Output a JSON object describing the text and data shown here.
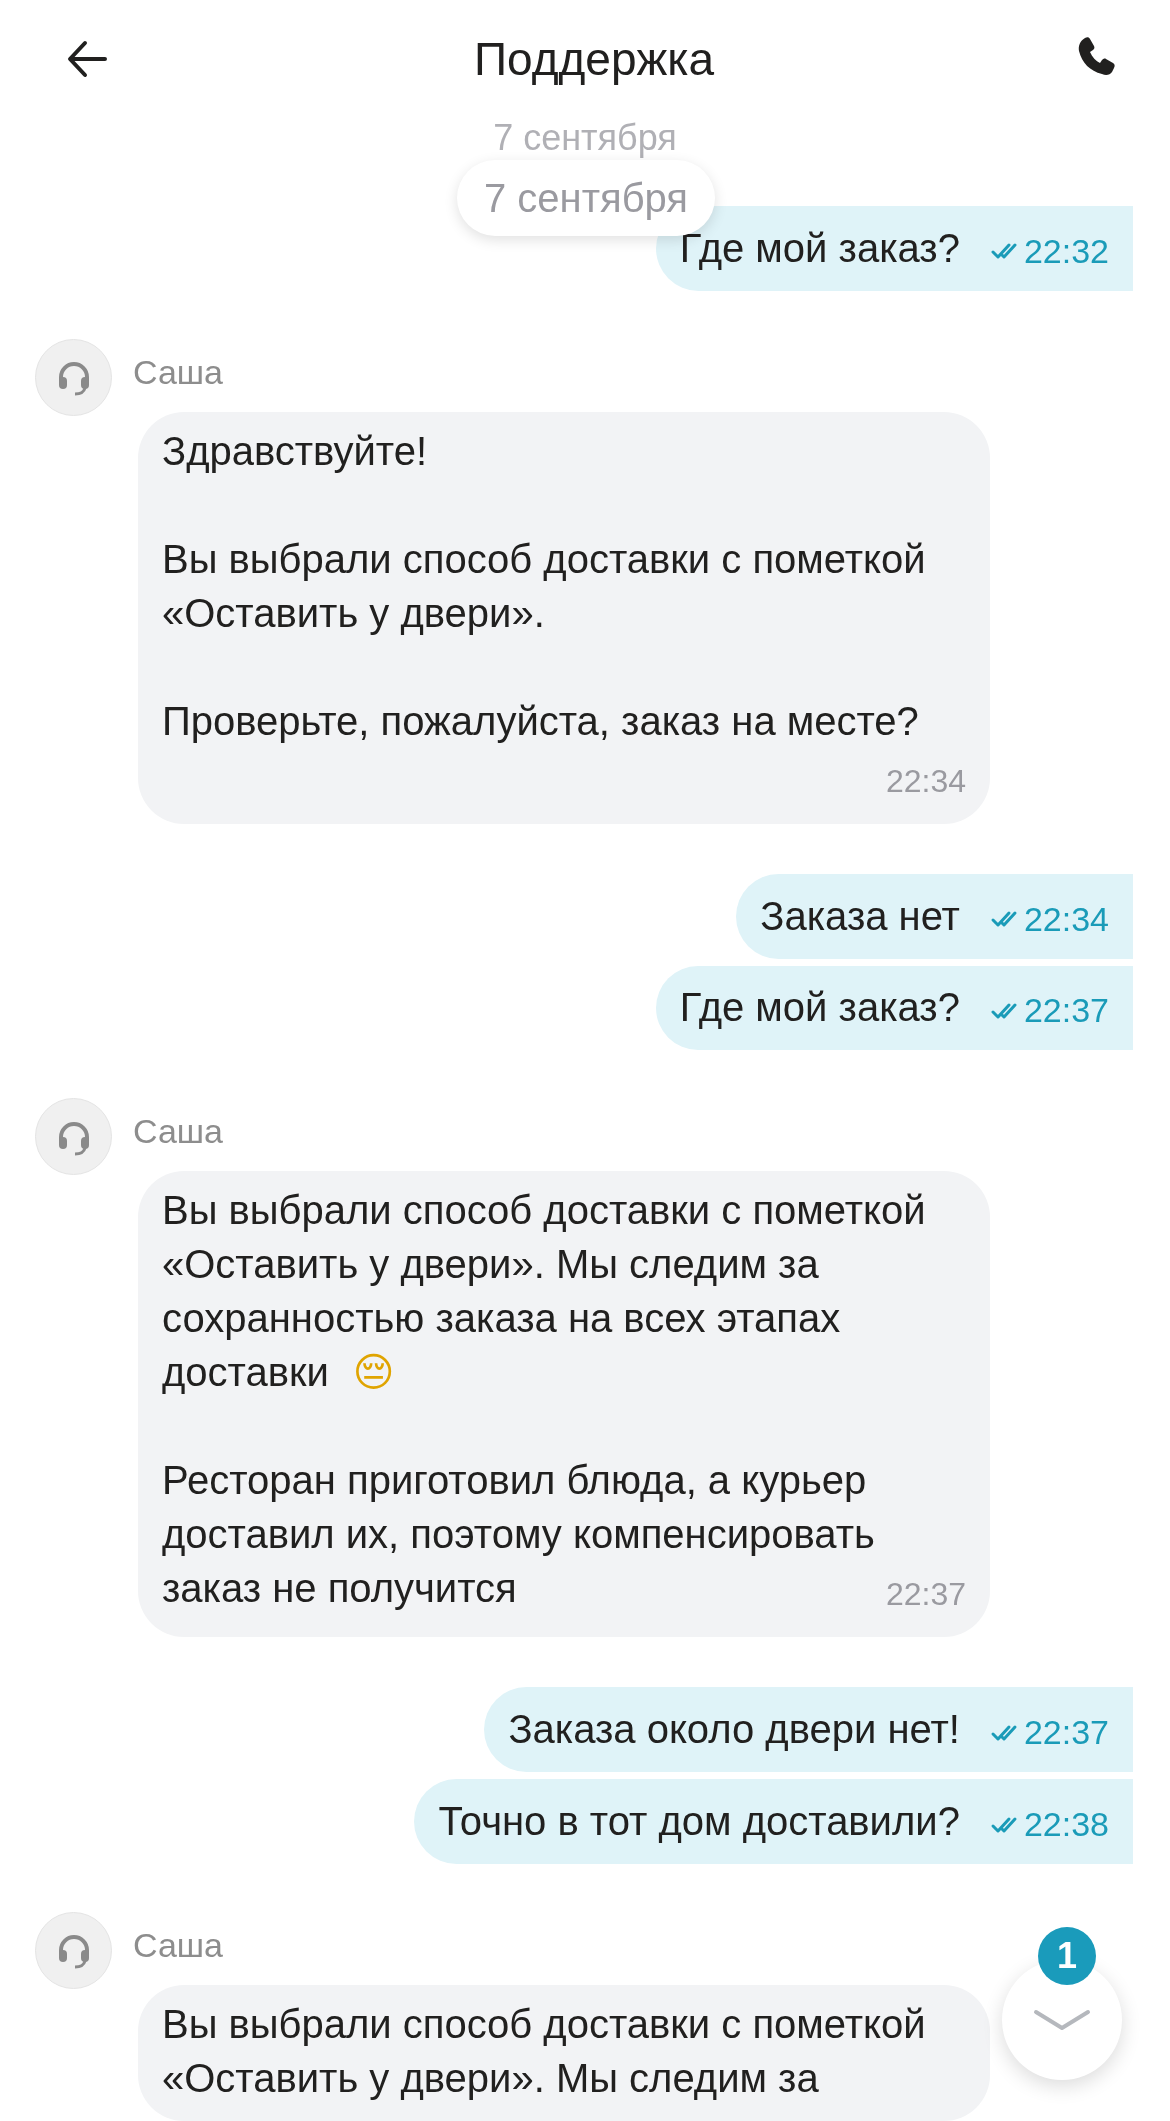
{
  "header": {
    "title": "Поддержка"
  },
  "scrolled_date": "7 сентября",
  "sticky_date": "7 сентября",
  "messages": [
    {
      "kind": "outgoing",
      "text": "Где мой заказ?",
      "time": "22:32",
      "read": true
    },
    {
      "kind": "incoming",
      "sender": "Саша",
      "paragraphs": [
        {
          "kind": "plain",
          "text": "Здравствуйте!"
        },
        {
          "kind": "plain",
          "text": "Вы выбрали способ доставки с пометкой\n«Оставить у двери»."
        },
        {
          "kind": "plain",
          "text": "Проверьте, пожалуйста, заказ на месте?"
        }
      ],
      "time": "22:34"
    },
    {
      "kind": "outgoing",
      "text": "Заказа нет",
      "time": "22:34",
      "read": true
    },
    {
      "kind": "outgoing",
      "text": "Где мой заказ?",
      "time": "22:37",
      "read": true
    },
    {
      "kind": "incoming",
      "sender": "Саша",
      "paragraphs": [
        {
          "kind": "with_emoji",
          "text": "Вы выбрали способ доставки с пометкой\n«Оставить у двери». Мы следим за\nсохранностью заказа на всех этапах\nдоставки",
          "emoji": "😔"
        },
        {
          "kind": "plain",
          "text": "Ресторан приготовил блюда, а курьер\nдоставил их, поэтому компенсировать\nзаказ не получится"
        }
      ],
      "time": "22:37"
    },
    {
      "kind": "outgoing",
      "text": "Заказа около двери нет!",
      "time": "22:37",
      "read": true
    },
    {
      "kind": "outgoing",
      "text": "Точно в тот дом доставили?",
      "time": "22:38",
      "read": true
    },
    {
      "kind": "incoming",
      "sender": "Саша",
      "paragraphs": [
        {
          "kind": "plain",
          "text": "Вы выбрали способ доставки с пометкой\n«Оставить у двери». Мы следим за"
        }
      ]
    }
  ],
  "scroll_button": {
    "unread_count": "1"
  }
}
